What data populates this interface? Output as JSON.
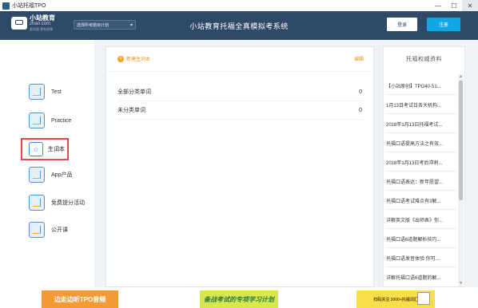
{
  "window": {
    "title": "小站托福TPO",
    "controls": [
      "—",
      "☐",
      "✕"
    ]
  },
  "header": {
    "logo_main": "小站教育",
    "logo_sub": "zhan.com",
    "logo_slogan": "留学路 更有保障",
    "selector_value": "选择所考题目计划",
    "app_title": "小站教育托福全真模拟考系统",
    "login_label": "登录",
    "register_label": "注册"
  },
  "sidebar": {
    "items": [
      {
        "label": "Test",
        "icon": "test-icon"
      },
      {
        "label": "Practice",
        "icon": "practice-icon"
      },
      {
        "label": "生词本",
        "icon": "vocab-book-icon",
        "active": true
      },
      {
        "label": "App产品",
        "icon": "app-grid-icon"
      },
      {
        "label": "免费提分活动",
        "icon": "people-icon"
      },
      {
        "label": "公开课",
        "icon": "open-class-icon"
      }
    ]
  },
  "vocab": {
    "new_list_label": "新建生词本",
    "manage_label": "编辑",
    "rows": [
      {
        "name": "全部分类单词",
        "count": "0"
      },
      {
        "name": "未分类单词",
        "count": "0"
      }
    ]
  },
  "resources": {
    "title": "托福权威资料",
    "items": [
      "【小站原创】TPO40-51...",
      "1月13日考试日各大机构...",
      "2018年1月13日托福考试...",
      "托福口语提高方法之有效...",
      "2018年1月13日考后冲刺...",
      "托福口语表达：新年愿望...",
      "托福口语考试难点有3解...",
      "详解英文版《出师表》你...",
      "托福口语6道题解析技巧...",
      "托福口语发音体验 你可...",
      "详解托福口语6道题的解..."
    ]
  },
  "banners": [
    {
      "text": "边走边听TPO音频"
    },
    {
      "text": "备战考试的专项学习计划"
    },
    {
      "text": "扫码关注 3000+托福词汇"
    }
  ]
}
